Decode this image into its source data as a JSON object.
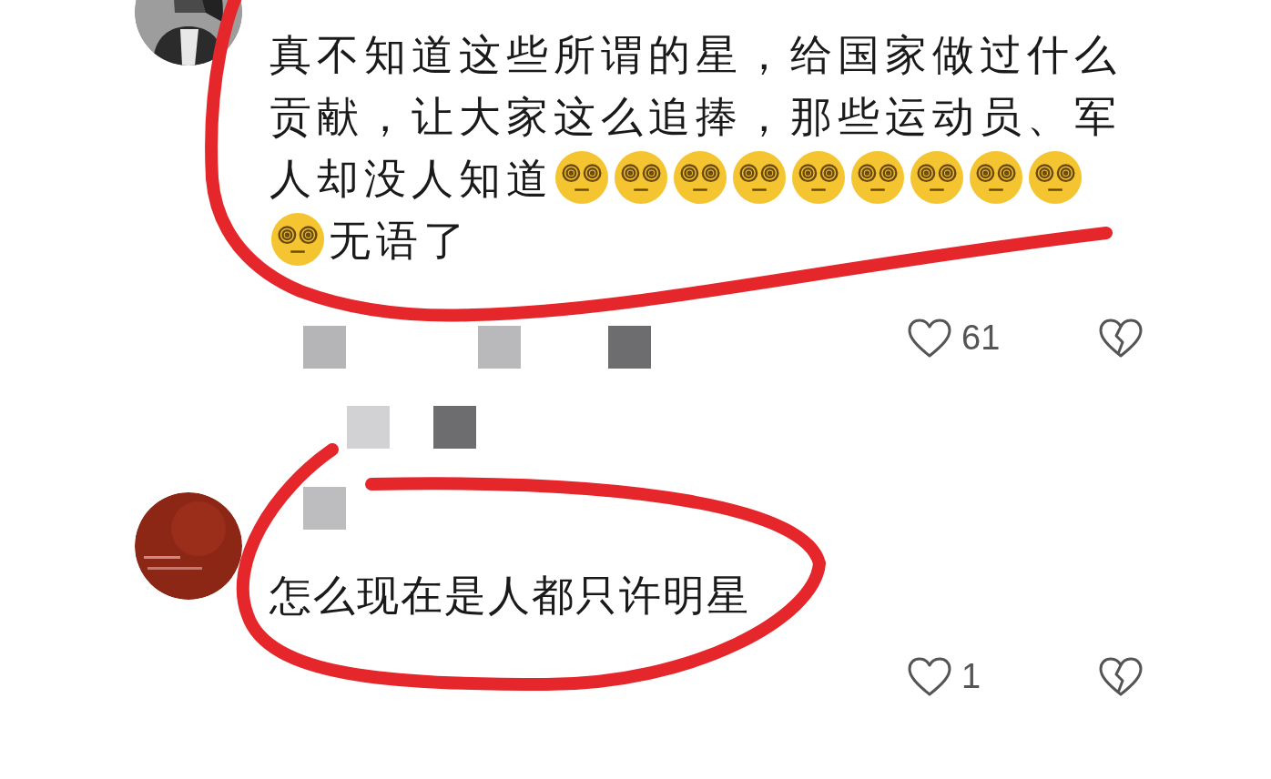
{
  "comments": [
    {
      "avatar": {
        "kind": "picture"
      },
      "content": [
        {
          "kind": "text",
          "text": "真不知道这些所谓的星，给国家做过什么贡献，让大家这么追捧，那些运动员、军"
        },
        {
          "kind": "text",
          "text": "人却没人知道"
        },
        {
          "kind": "emoji"
        },
        {
          "kind": "emoji"
        },
        {
          "kind": "emoji"
        },
        {
          "kind": "emoji"
        },
        {
          "kind": "emoji"
        },
        {
          "kind": "emoji"
        },
        {
          "kind": "emoji"
        },
        {
          "kind": "emoji"
        },
        {
          "kind": "emoji"
        },
        {
          "kind": "emoji"
        },
        {
          "kind": "text",
          "text": "无语了"
        }
      ],
      "likes": "61"
    },
    {
      "avatar": {
        "kind": "picture"
      },
      "content": [
        {
          "kind": "text",
          "text": "怎么现在是人都只许明星"
        }
      ],
      "likes": "1"
    }
  ]
}
